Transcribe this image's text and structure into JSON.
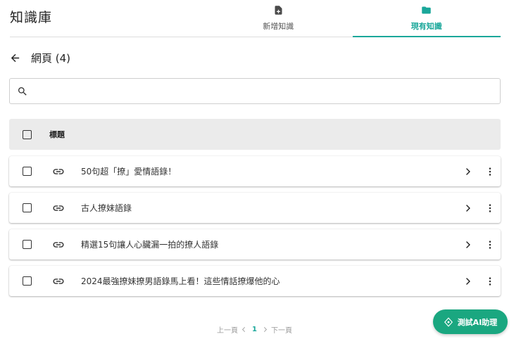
{
  "app": {
    "title": "知識庫"
  },
  "tabs": [
    {
      "label": "新增知識",
      "icon": "file-add-icon",
      "active": false
    },
    {
      "label": "現有知識",
      "icon": "folder-icon",
      "active": true
    }
  ],
  "page": {
    "title": "網頁 (4)"
  },
  "search": {
    "placeholder": "",
    "value": ""
  },
  "table": {
    "header": "標題",
    "rows": [
      {
        "title": "50句超「撩」愛情語錄！"
      },
      {
        "title": "古人撩妹語錄"
      },
      {
        "title": "精選15句讓人心臟漏一拍的撩人語錄"
      },
      {
        "title": "2024最強撩妹撩男語錄馬上看！這些情話撩爆他的心"
      }
    ]
  },
  "pagination": {
    "prev": "上一頁",
    "current": "1",
    "next": "下一頁"
  },
  "ai_button": {
    "label": "測試AI助理"
  },
  "colors": {
    "accent": "#1aa79a",
    "ai_button": "#1aa780",
    "header_bg": "#ebebeb"
  }
}
